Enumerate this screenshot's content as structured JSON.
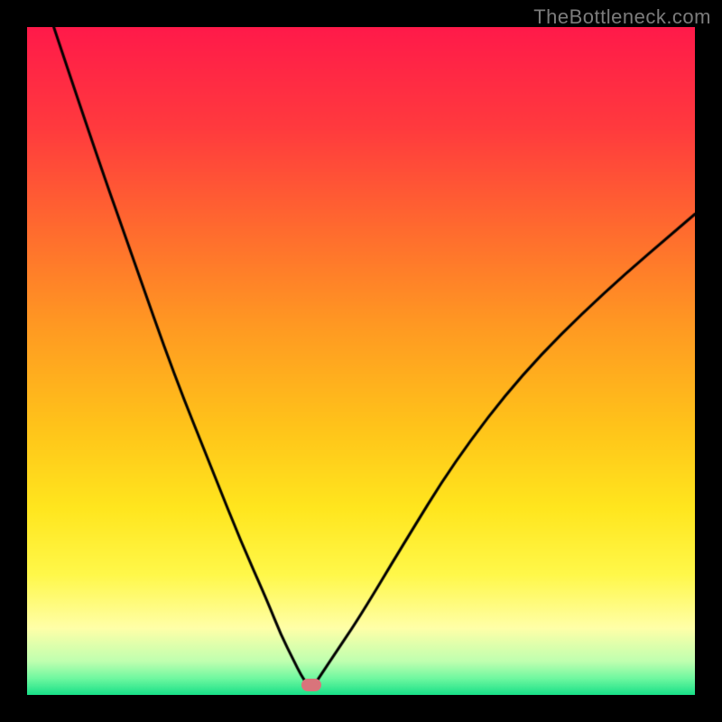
{
  "watermark": "TheBottleneck.com",
  "colors": {
    "frame": "#000000",
    "marker": "#d9747b",
    "curve": "#000000",
    "gradient_stops": [
      {
        "offset": 0.0,
        "color": "#ff1a4a"
      },
      {
        "offset": 0.15,
        "color": "#ff3a3e"
      },
      {
        "offset": 0.3,
        "color": "#ff6a2f"
      },
      {
        "offset": 0.45,
        "color": "#ff9a22"
      },
      {
        "offset": 0.6,
        "color": "#ffc41a"
      },
      {
        "offset": 0.72,
        "color": "#ffe61e"
      },
      {
        "offset": 0.82,
        "color": "#fff84a"
      },
      {
        "offset": 0.9,
        "color": "#ffffa8"
      },
      {
        "offset": 0.95,
        "color": "#bfffb0"
      },
      {
        "offset": 0.975,
        "color": "#70f8a0"
      },
      {
        "offset": 1.0,
        "color": "#18e088"
      }
    ]
  },
  "chart_data": {
    "type": "line",
    "title": "",
    "xlabel": "",
    "ylabel": "",
    "xlim": [
      0,
      100
    ],
    "ylim": [
      0,
      100
    ],
    "annotations": [
      {
        "name": "optimal-marker",
        "x": 42.5,
        "y": 1.5
      }
    ],
    "series": [
      {
        "name": "bottleneck-curve",
        "x": [
          4,
          10,
          16,
          22,
          28,
          32,
          36,
          38,
          40,
          41,
          42,
          42.5,
          43,
          44,
          46,
          50,
          56,
          64,
          74,
          86,
          100
        ],
        "values": [
          100,
          82,
          65,
          48,
          33,
          23,
          14,
          9,
          5,
          3,
          1.5,
          1,
          1.5,
          3,
          6,
          12,
          22,
          35,
          48,
          60,
          72
        ]
      }
    ]
  }
}
